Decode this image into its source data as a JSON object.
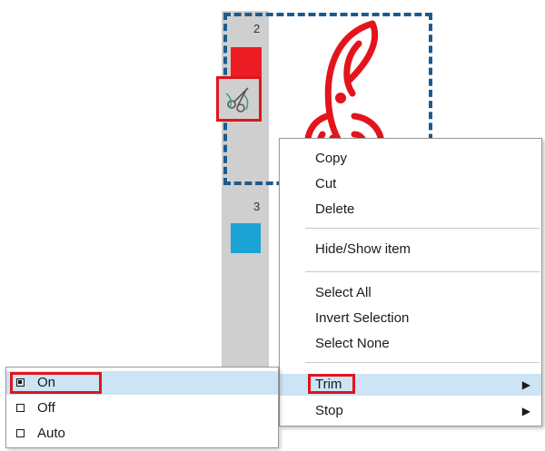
{
  "layers": {
    "layer_2_number": "2",
    "layer_3_number": "3",
    "layer_2_color": "#ed1c24",
    "layer_3_color": "#1ba3d6"
  },
  "context_menu": {
    "items": [
      {
        "label": "Copy"
      },
      {
        "label": "Cut"
      },
      {
        "label": "Delete"
      },
      {
        "label": "Hide/Show item"
      },
      {
        "label": "Select All"
      },
      {
        "label": "Invert Selection"
      },
      {
        "label": "Select None"
      },
      {
        "label": "Trim",
        "has_submenu": true
      },
      {
        "label": "Stop",
        "has_submenu": true
      }
    ],
    "submenu_arrow": "▶"
  },
  "trim_submenu": {
    "items": [
      {
        "label": "On",
        "checked": true
      },
      {
        "label": "Off",
        "checked": false
      },
      {
        "label": "Auto",
        "checked": false
      }
    ]
  },
  "icons": {
    "cut_mode": "scissors-icon"
  },
  "colors": {
    "highlight": "#cce4f4",
    "annotation_red": "#e0141e",
    "selection_dash": "#1f5a8a"
  }
}
